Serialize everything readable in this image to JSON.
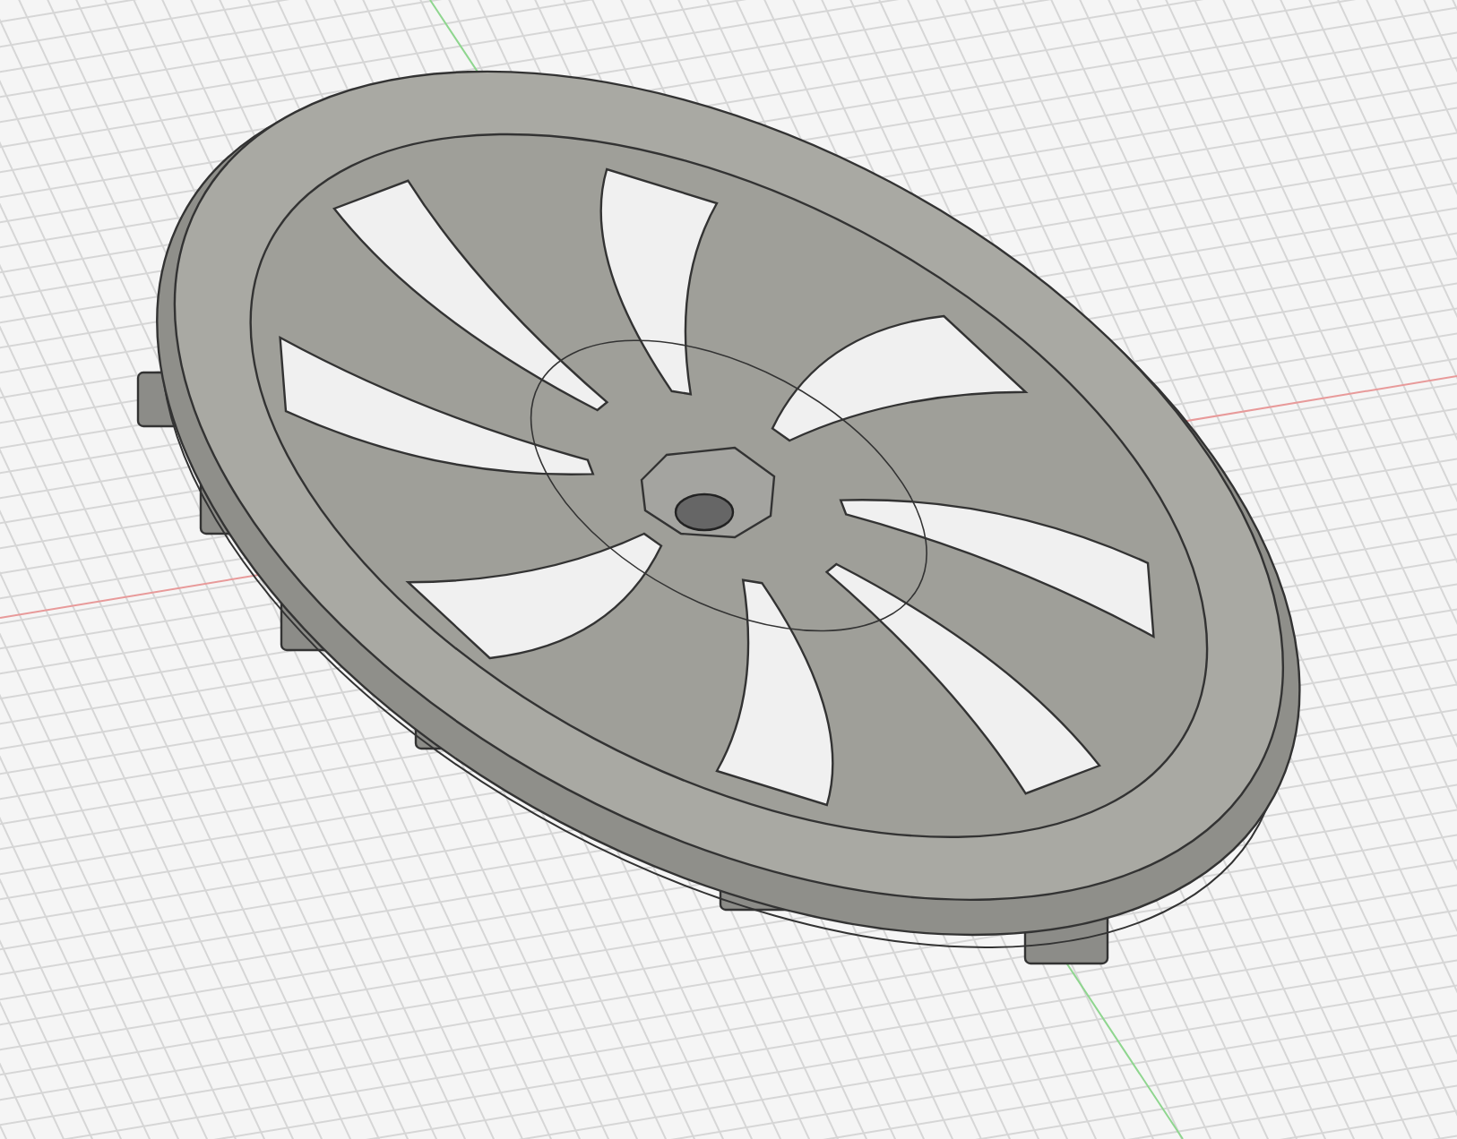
{
  "viewport": {
    "grid": true,
    "axes": true,
    "model": {
      "kind": "hubcap"
    }
  }
}
